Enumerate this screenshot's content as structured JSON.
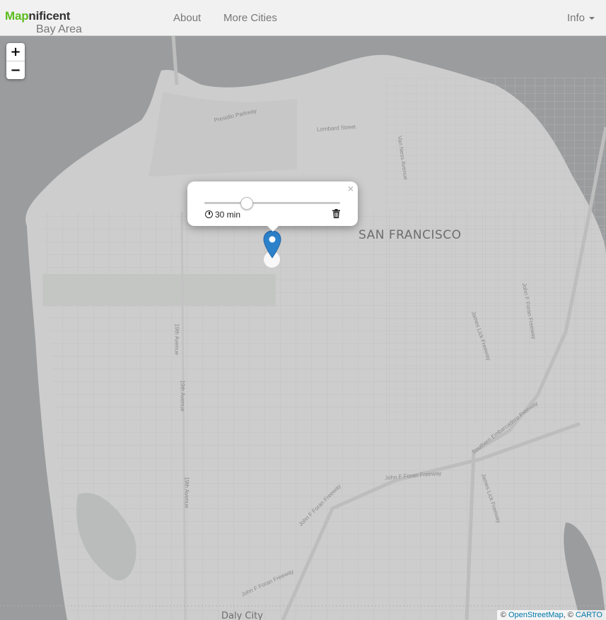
{
  "navbar": {
    "brand_accent": "Map",
    "brand_rest": "nificent",
    "brand_sub": "Bay Area",
    "links": [
      "About",
      "More Cities"
    ],
    "info_label": "Info"
  },
  "zoom": {
    "in_label": "+",
    "out_label": "−"
  },
  "popup": {
    "close_label": "×",
    "time_label": "30 min",
    "slider_fraction": 0.31
  },
  "map": {
    "city_label": "SAN FRANCISCO",
    "partial_label": "Daly City",
    "streets": {
      "presidio": "Presidio Parkway",
      "lombard": "Lombard Street",
      "vanness": "Van Ness Avenue",
      "ave19": "19th Avenue",
      "ave19b": "19th Avenue",
      "ave19c": "19th Avenue",
      "jlick": "James Lick Freeway",
      "jlick2": "James Lick Freeway",
      "jfforan": "John F Foran Freeway",
      "jfforan2": "John F Foran Freeway",
      "jfforan3": "John F Foran Freeway",
      "jfforan4": "John F Foran Freeway",
      "embarcadero": "Southern Embarcadero Freeway"
    }
  },
  "attribution": {
    "prefix": "© ",
    "osm": "OpenStreetMap",
    "sep": ", © ",
    "carto": "CARTO"
  },
  "colors": {
    "accent": "#5cbd1e",
    "marker": "#2b82cb",
    "land": "#cdcdcd",
    "water": "#9a9c9d"
  }
}
